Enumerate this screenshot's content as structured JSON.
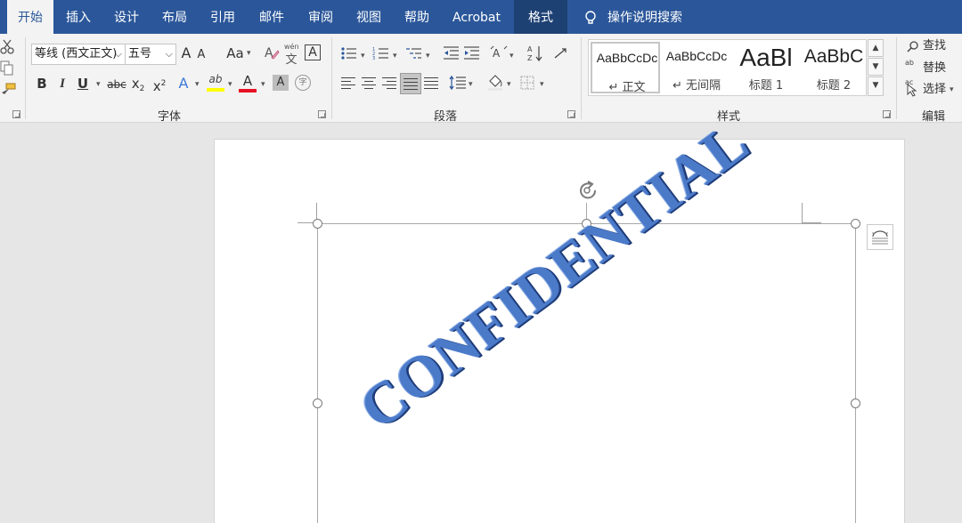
{
  "tabs": [
    {
      "label": "开始",
      "active": true
    },
    {
      "label": "插入"
    },
    {
      "label": "设计"
    },
    {
      "label": "布局"
    },
    {
      "label": "引用"
    },
    {
      "label": "邮件"
    },
    {
      "label": "审阅"
    },
    {
      "label": "视图"
    },
    {
      "label": "帮助"
    },
    {
      "label": "Acrobat"
    },
    {
      "label": "格式",
      "contextual": true
    }
  ],
  "tell_me": "操作说明搜索",
  "font_group": {
    "label": "字体",
    "font_name": "等线 (西文正文)",
    "font_size": "五号",
    "grow": "A",
    "shrink": "A",
    "change_case": "Aa",
    "phonetic": "wén",
    "phonetic_char": "文",
    "border_char": "A",
    "bold": "B",
    "italic": "I",
    "underline": "U",
    "strike": "abc",
    "subscript": "x",
    "superscript": "x",
    "sub_mark": "2",
    "sup_mark": "2",
    "text_effect": "A",
    "highlight": "ab",
    "font_color": "A",
    "char_shading": "A",
    "enclose": "字"
  },
  "paragraph_group": {
    "label": "段落"
  },
  "styles_group": {
    "label": "样式",
    "items": [
      {
        "sample": "AaBbCcDc",
        "name": "正文",
        "selected": true
      },
      {
        "sample": "AaBbCcDc",
        "name": "无间隔"
      },
      {
        "sample": "AaBl",
        "name": "标题 1"
      },
      {
        "sample": "AaBbC",
        "name": "标题 2"
      }
    ]
  },
  "editing_group": {
    "label": "编辑",
    "find": "查找",
    "replace": "替换",
    "select": "选择"
  },
  "document": {
    "wordart_text": "CONFIDENTIAL"
  },
  "colors": {
    "tab_bar": "#2b579a",
    "contextual_tab": "#1e4174",
    "ribbon": "#f3f3f3",
    "wordart": "#4b7ac9",
    "font_color_bar": "#e81123",
    "highlight_bar": "#ffff00"
  }
}
